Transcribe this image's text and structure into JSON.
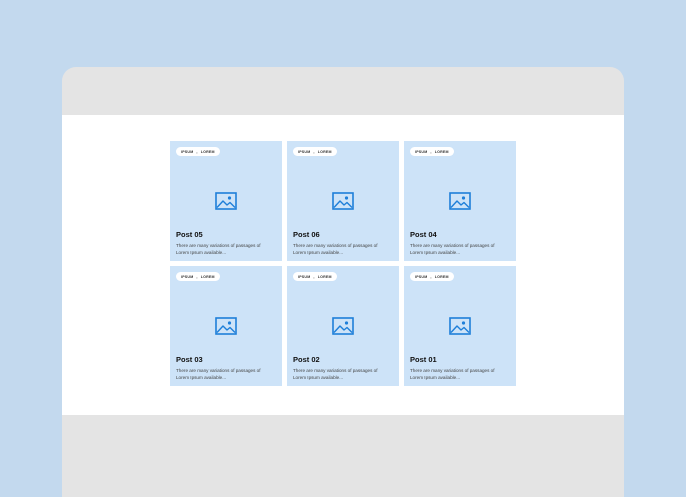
{
  "colors": {
    "background": "#c3d9ee",
    "window_chrome": "#e4e4e4",
    "content": "#ffffff",
    "card": "#cde3f8",
    "icon": "#1e7fd9"
  },
  "posts": [
    {
      "tag1": "IPSUM",
      "sep": ",",
      "tag2": "LOREM",
      "icon": "image-icon",
      "title": "Post 05",
      "desc_line1": "There are many variations of passages of",
      "desc_line2": "Lorem Ipsum available..."
    },
    {
      "tag1": "IPSUM",
      "sep": ",",
      "tag2": "LOREM",
      "icon": "image-icon",
      "title": "Post 06",
      "desc_line1": "There are many variations of passages of",
      "desc_line2": "Lorem Ipsum available..."
    },
    {
      "tag1": "IPSUM",
      "sep": ",",
      "tag2": "LOREM",
      "icon": "image-icon",
      "title": "Post 04",
      "desc_line1": "There are many variations of passages of",
      "desc_line2": "Lorem Ipsum available..."
    },
    {
      "tag1": "IPSUM",
      "sep": ",",
      "tag2": "LOREM",
      "icon": "image-icon",
      "title": "Post 03",
      "desc_line1": "There are many variations of passages of",
      "desc_line2": "Lorem Ipsum available..."
    },
    {
      "tag1": "IPSUM",
      "sep": ",",
      "tag2": "LOREM",
      "icon": "image-icon",
      "title": "Post 02",
      "desc_line1": "There are many variations of passages of",
      "desc_line2": "Lorem Ipsum available..."
    },
    {
      "tag1": "IPSUM",
      "sep": ",",
      "tag2": "LOREM",
      "icon": "image-icon",
      "title": "Post 01",
      "desc_line1": "There are many variations of passages of",
      "desc_line2": "Lorem Ipsum available..."
    }
  ]
}
